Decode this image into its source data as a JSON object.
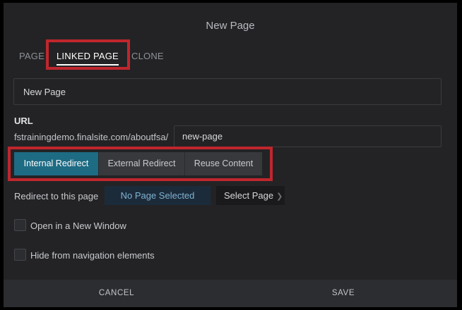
{
  "dialog": {
    "title": "New Page"
  },
  "tabs": [
    {
      "label": "PAGE"
    },
    {
      "label": "LINKED PAGE"
    },
    {
      "label": "CLONE"
    }
  ],
  "page_title_field": {
    "value": "New Page"
  },
  "url": {
    "label": "URL",
    "prefix": "fstrainingdemo.finalsite.com/aboutfsa/",
    "slug": "new-page"
  },
  "redirect_types": [
    {
      "label": "Internal Redirect",
      "selected": true
    },
    {
      "label": "External Redirect",
      "selected": false
    },
    {
      "label": "Reuse Content",
      "selected": false
    }
  ],
  "redirect": {
    "label": "Redirect to this page",
    "selected_value": "No Page Selected",
    "select_button": "Select Page",
    "select_chevron": "❯"
  },
  "options": [
    {
      "label": "Open in a New Window",
      "checked": false
    },
    {
      "label": "Hide from navigation elements",
      "checked": false
    }
  ],
  "footer": {
    "cancel": "CANCEL",
    "save": "SAVE"
  },
  "colors": {
    "background": "#232325",
    "accent": "#1e6b84",
    "highlight_box": "#c0262d",
    "footer": "#2c2d30"
  }
}
